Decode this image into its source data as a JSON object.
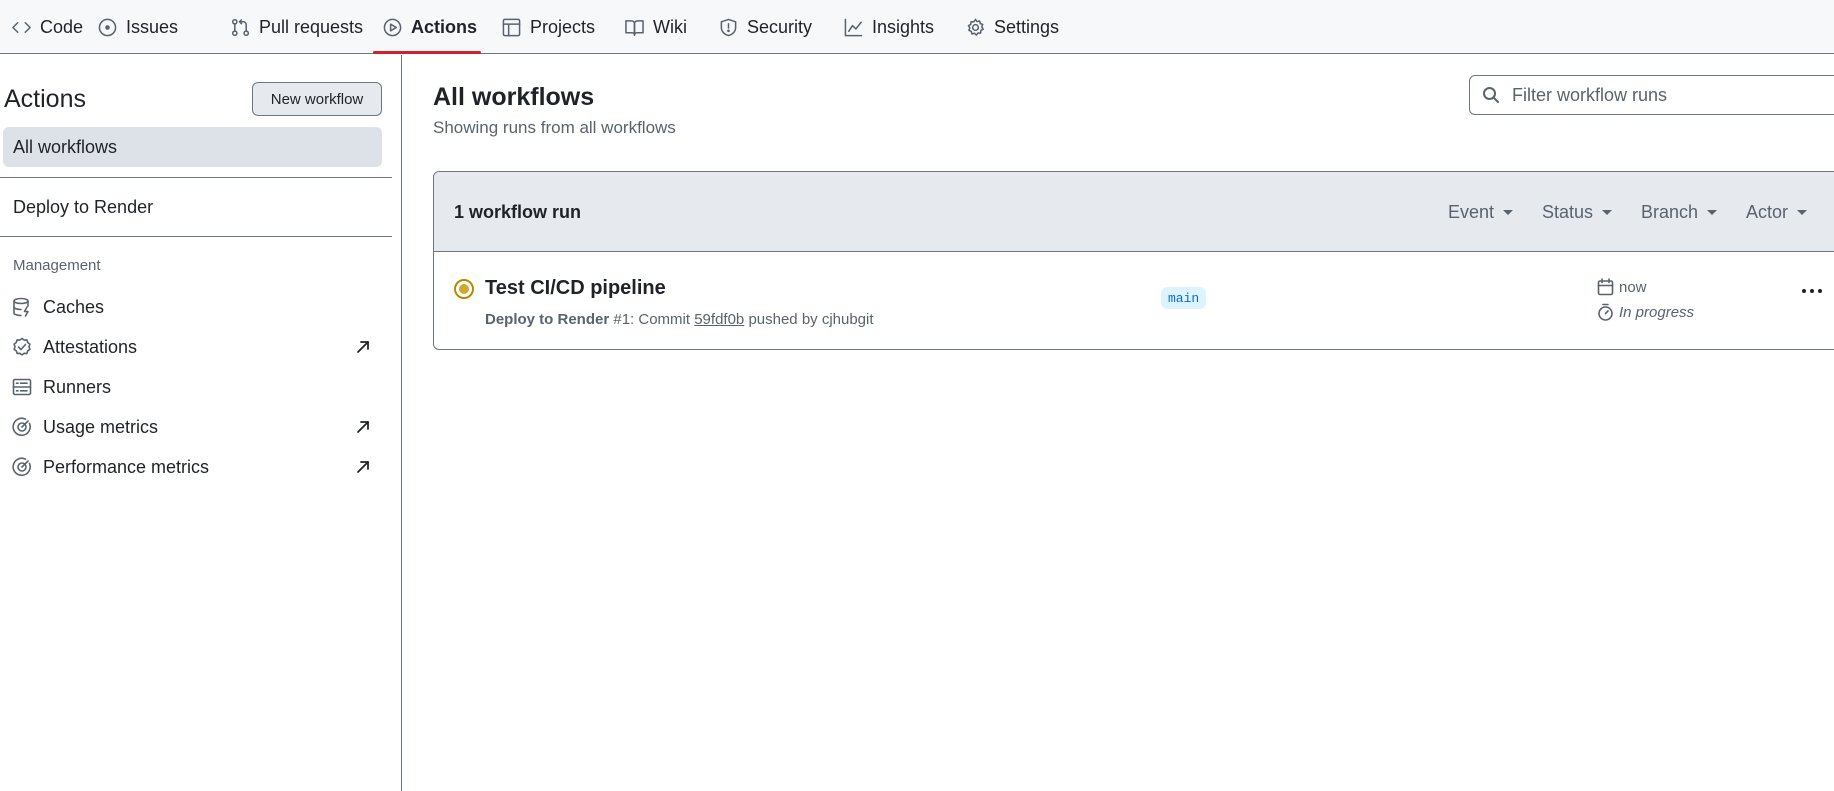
{
  "nav": {
    "tabs": [
      {
        "label": "Code",
        "icon": "code-icon"
      },
      {
        "label": "Issues",
        "icon": "issue-icon"
      },
      {
        "label": "Pull requests",
        "icon": "pull-request-icon"
      },
      {
        "label": "Actions",
        "icon": "play-icon"
      },
      {
        "label": "Projects",
        "icon": "table-icon"
      },
      {
        "label": "Wiki",
        "icon": "book-icon"
      },
      {
        "label": "Security",
        "icon": "shield-icon"
      },
      {
        "label": "Insights",
        "icon": "graph-icon"
      },
      {
        "label": "Settings",
        "icon": "gear-icon"
      }
    ],
    "active_tab": "Actions"
  },
  "sidebar": {
    "title": "Actions",
    "new_workflow_label": "New workflow",
    "workflows": [
      {
        "label": "All workflows",
        "selected": true
      },
      {
        "label": "Deploy to Render",
        "selected": false
      }
    ],
    "management_heading": "Management",
    "management": [
      {
        "label": "Caches",
        "icon": "database-icon",
        "external": false
      },
      {
        "label": "Attestations",
        "icon": "verified-icon",
        "external": true
      },
      {
        "label": "Runners",
        "icon": "server-icon",
        "external": false
      },
      {
        "label": "Usage metrics",
        "icon": "meter-icon",
        "external": true
      },
      {
        "label": "Performance metrics",
        "icon": "meter-icon",
        "external": true
      }
    ]
  },
  "main": {
    "title": "All workflows",
    "subtitle": "Showing runs from all workflows",
    "filter_placeholder": "Filter workflow runs",
    "run_count": "1 workflow run",
    "filters": [
      "Event",
      "Status",
      "Branch",
      "Actor"
    ],
    "runs": [
      {
        "title": "Test CI/CD pipeline",
        "workflow": "Deploy to Render",
        "run_number": "#1: Commit",
        "commit": "59fdf0b",
        "pushed_by": "pushed by cjhubgit",
        "branch": "main",
        "time": "now",
        "duration": "In progress",
        "status_color": "#d4a72c"
      }
    ]
  },
  "colors": {
    "active_tab_underline": "#cf222e",
    "nav_bg": "#f6f8fa",
    "branch_bg": "#ddf4ff",
    "branch_text": "#0969da"
  }
}
